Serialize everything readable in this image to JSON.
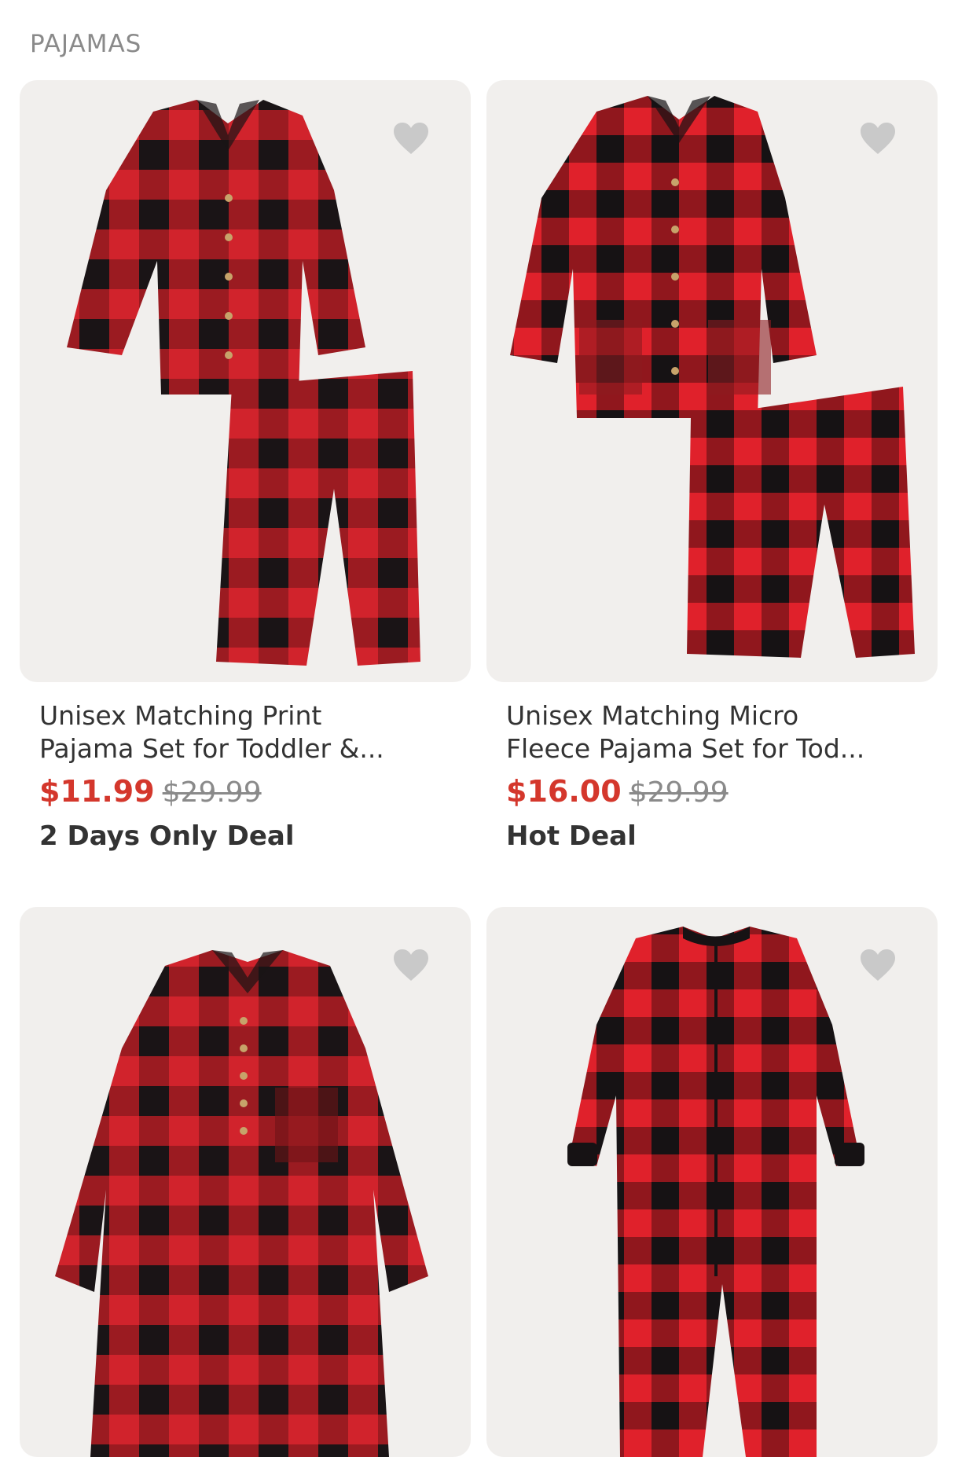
{
  "section": {
    "title": "PAJAMAS"
  },
  "colors": {
    "sale": "#d4372c",
    "original": "#8a8a8a",
    "plaid_red": "#d1232c",
    "plaid_dark": "#1a1416",
    "card_bg": "#f1efed"
  },
  "products": [
    {
      "name_line1": "Unisex Matching Print",
      "name_line2": "Pajama Set for Toddler &...",
      "sale_price": "$11.99",
      "original_price": "$29.99",
      "badge": "2 Days Only Deal",
      "favorite_icon": "heart-icon"
    },
    {
      "name_line1": "Unisex Matching Micro",
      "name_line2": "Fleece Pajama Set for Tod...",
      "sale_price": "$16.00",
      "original_price": "$29.99",
      "badge": "Hot Deal",
      "favorite_icon": "heart-icon"
    },
    {
      "favorite_icon": "heart-icon"
    },
    {
      "favorite_icon": "heart-icon"
    }
  ]
}
